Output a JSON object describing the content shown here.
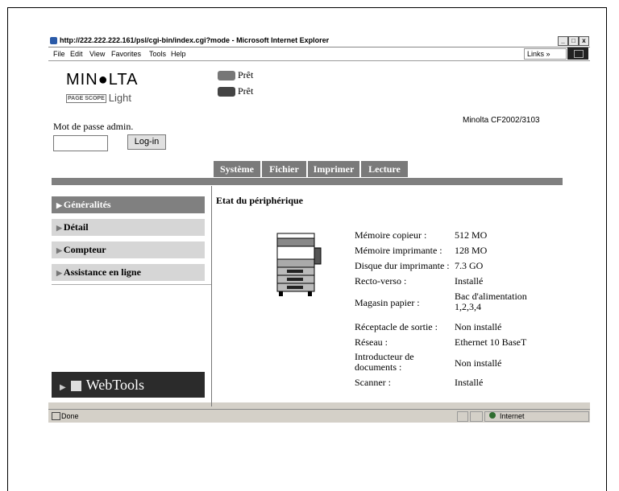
{
  "browser": {
    "title": "http://222.222.222.161/psl/cgi-bin/index.cgi?mode - Microsoft Internet Explorer",
    "buttons": {
      "minimize": "_",
      "maximize": "□",
      "close": "x"
    },
    "menu": [
      "File",
      "Edit",
      "View",
      "Favorites",
      "Tools",
      "Help"
    ],
    "links": "Links »",
    "status_text": "Done",
    "zone": "Internet"
  },
  "header": {
    "logo": "MIN●LTA",
    "product_badge": "PAGE SCOPE",
    "product": "Light",
    "status1": "Prêt",
    "status2": "Prêt",
    "model": "Minolta CF2002/3103",
    "password_label": "Mot de passe admin.",
    "password_value": "",
    "login_button": "Log-in"
  },
  "tabs": [
    "Système",
    "Fichier",
    "Imprimer",
    "Lecture"
  ],
  "sidebar": {
    "items": [
      {
        "label": "Généralités",
        "arrow": "▶"
      },
      {
        "label": "Détail",
        "arrow": "▶"
      },
      {
        "label": "Compteur",
        "arrow": "▶"
      },
      {
        "label": "Assistance en ligne",
        "arrow": "▶"
      }
    ],
    "webtools_label": "WebTools",
    "webtools_arrow": "▶"
  },
  "main": {
    "heading": "Etat du périphérique",
    "rows": [
      {
        "label": "Mémoire copieur :",
        "value": "512 MO"
      },
      {
        "label": "Mémoire imprimante :",
        "value": "128 MO"
      },
      {
        "label": "Disque dur imprimante :",
        "value": "7.3 GO"
      },
      {
        "label": "Recto-verso :",
        "value": "Installé"
      },
      {
        "label": "Magasin papier :",
        "value": "Bac d'alimentation 1,2,3,4"
      },
      {
        "label": "Réceptacle de sortie :",
        "value": "Non installé"
      },
      {
        "label": "Réseau :",
        "value": "Ethernet 10 BaseT"
      },
      {
        "label": "Introducteur de documents :",
        "value": "Non installé"
      },
      {
        "label": "Scanner :",
        "value": "Installé"
      }
    ]
  }
}
